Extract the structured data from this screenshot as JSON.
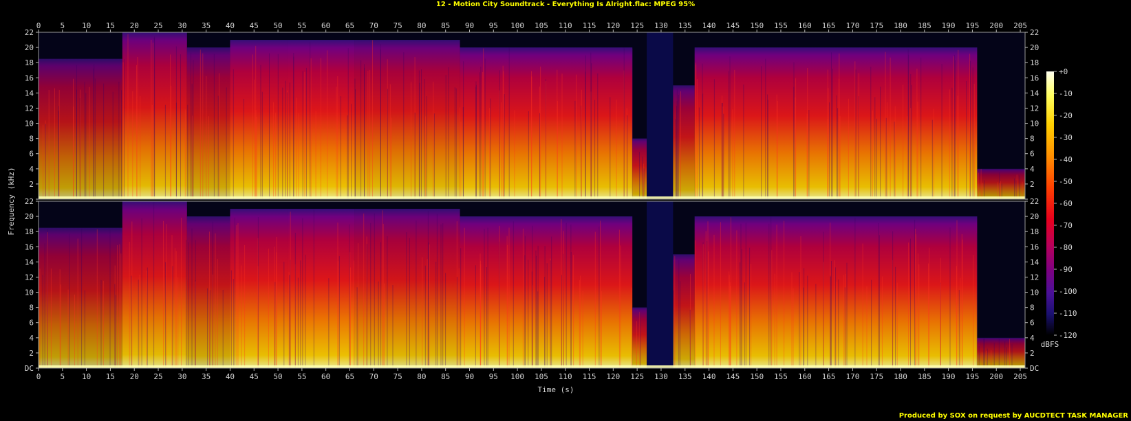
{
  "header": {
    "title": "12 - Motion City Soundtrack - Everything Is Alright.flac: MPEG 95%"
  },
  "footer": {
    "credit": "Produced by SOX on request by AUCDTECT TASK MANAGER"
  },
  "chart_data": {
    "type": "heatmap",
    "channels": 2,
    "xlabel": "Time (s)",
    "ylabel": "Frequency (kHz)",
    "xlim": [
      0,
      206
    ],
    "ylim": [
      0,
      22
    ],
    "x_ticks": [
      0,
      5,
      10,
      15,
      20,
      25,
      30,
      35,
      40,
      45,
      50,
      55,
      60,
      65,
      70,
      75,
      80,
      85,
      90,
      95,
      100,
      105,
      110,
      115,
      120,
      125,
      130,
      135,
      140,
      145,
      150,
      155,
      160,
      165,
      170,
      175,
      180,
      185,
      190,
      195,
      200,
      205
    ],
    "y_tick_labels": [
      "DC",
      "2",
      "4",
      "6",
      "8",
      "10",
      "12",
      "14",
      "16",
      "18",
      "20",
      "22"
    ],
    "y_ticks_kHz": [
      0,
      2,
      4,
      6,
      8,
      10,
      12,
      14,
      16,
      18,
      20,
      22
    ],
    "colorbar": {
      "unit": "dBFS",
      "range": [
        -120,
        0
      ],
      "tick_labels": [
        "+0",
        "-10",
        "-20",
        "-30",
        "-40",
        "-50",
        "-60",
        "-70",
        "-80",
        "-90",
        "-100",
        "-110",
        "-120"
      ],
      "stops": [
        "#fffff0",
        "#ffff60",
        "#ffd000",
        "#ff9000",
        "#ff4000",
        "#e8001c",
        "#b8005a",
        "#800080",
        "#4a1098",
        "#1a1070",
        "#050530",
        "#000000"
      ]
    },
    "sections": [
      {
        "t": [
          0,
          17.5
        ],
        "top_kHz": 18.5,
        "level": 0.45
      },
      {
        "t": [
          17.5,
          31
        ],
        "top_kHz": 22,
        "level": 0.75
      },
      {
        "t": [
          31,
          40
        ],
        "top_kHz": 20,
        "level": 0.55
      },
      {
        "t": [
          40,
          52
        ],
        "top_kHz": 21,
        "level": 0.8
      },
      {
        "t": [
          52,
          66
        ],
        "top_kHz": 21,
        "level": 0.82
      },
      {
        "t": [
          66,
          88
        ],
        "top_kHz": 21,
        "level": 0.72
      },
      {
        "t": [
          88,
          124
        ],
        "top_kHz": 20,
        "level": 0.8
      },
      {
        "t": [
          124,
          127
        ],
        "top_kHz": 8,
        "level": 0.55
      },
      {
        "t": [
          127,
          132.5
        ],
        "top_kHz": 0,
        "level": 0.05
      },
      {
        "t": [
          132.5,
          137
        ],
        "top_kHz": 15,
        "level": 0.55
      },
      {
        "t": [
          137,
          196
        ],
        "top_kHz": 20,
        "level": 0.8
      },
      {
        "t": [
          196,
          206
        ],
        "top_kHz": 4,
        "level": 0.35
      }
    ]
  }
}
